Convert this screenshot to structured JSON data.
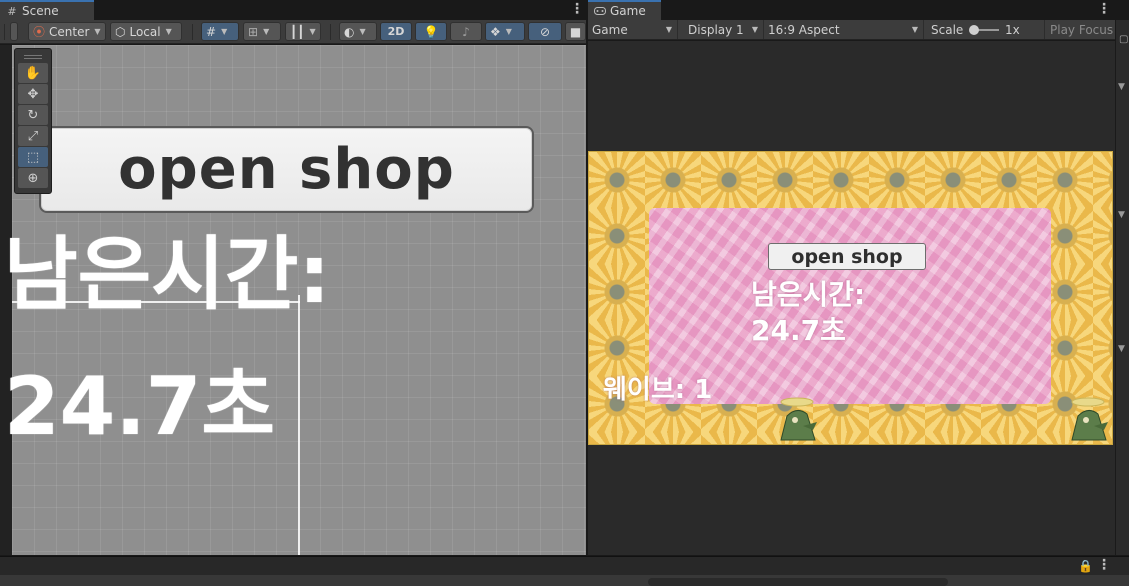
{
  "scene_tab": {
    "label": "Scene",
    "icon": "hash-icon"
  },
  "game_tab": {
    "label": "Game",
    "icon": "gamepad-icon"
  },
  "scene_toolbar": {
    "pivot_label": "Center",
    "space_label": "Local",
    "mode_2d_label": "2D"
  },
  "game_toolbar": {
    "view_select": "Game",
    "display_select": "Display 1",
    "aspect_select": "16:9 Aspect",
    "scale_label": "Scale",
    "scale_value": "1x",
    "play_focus_label": "Play Focus"
  },
  "scene_content": {
    "button_label": "open shop",
    "timer_line1": "남은시간:",
    "timer_line2": "24.7초"
  },
  "game_content": {
    "button_label": "open shop",
    "timer_line1": "남은시간:",
    "timer_line2": "24.7초",
    "wave_label": "웨이브: 1"
  },
  "colors": {
    "accent": "#3a72b0",
    "active_tool": "#46607c",
    "scene_bg": "#8f8f8f",
    "pink": "#eba9cc",
    "flower_yellow": "#f0c86a"
  }
}
